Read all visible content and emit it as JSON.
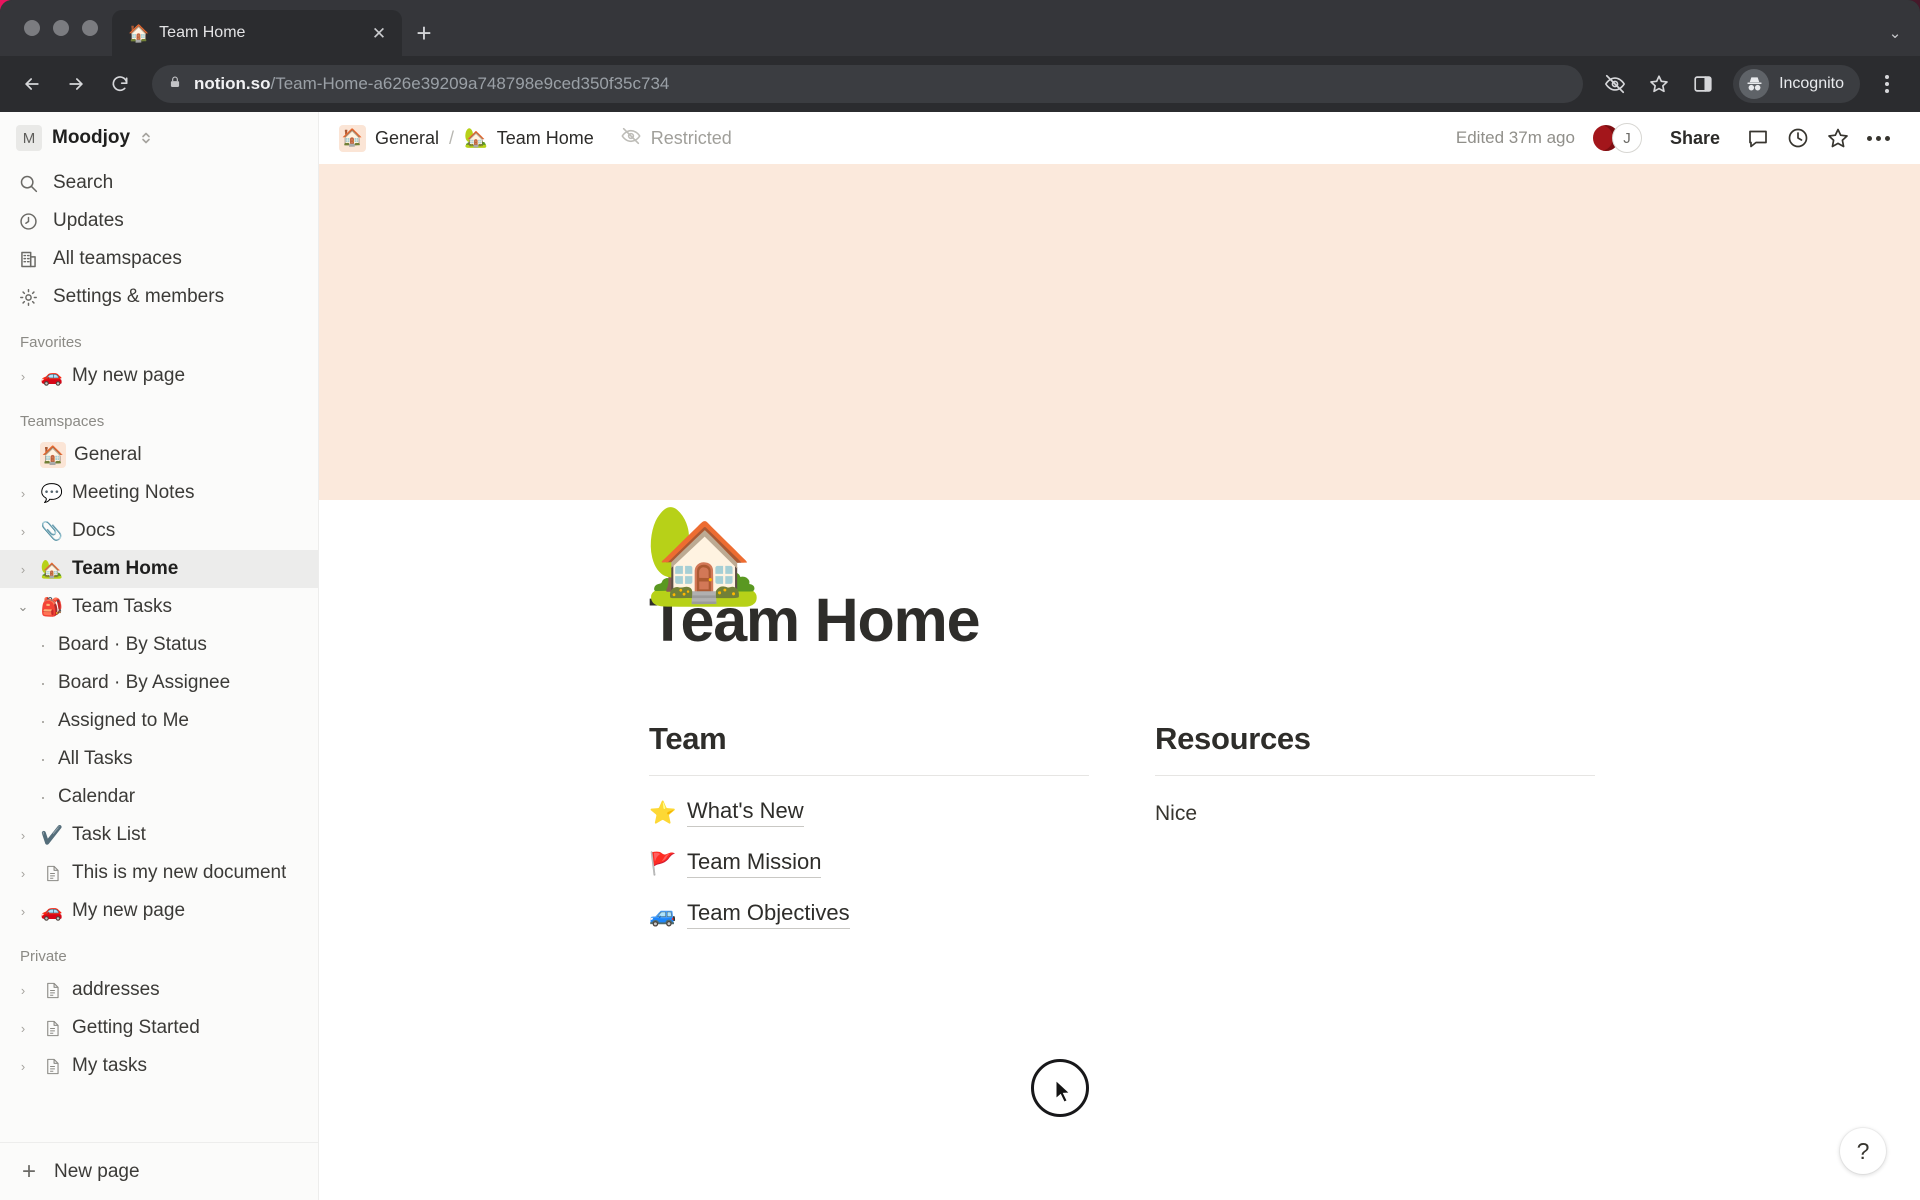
{
  "browser": {
    "tab": {
      "favicon": "🏠",
      "title": "Team Home",
      "close": "✕"
    },
    "new_tab_label": "+",
    "tab_list_chevron": "⌄",
    "omnibox": {
      "host": "notion.so",
      "path": "/Team-Home-a626e39209a748798e9ced350f35c734"
    },
    "profile_label": "Incognito",
    "icons": {
      "back": "back-arrow-icon",
      "forward": "forward-arrow-icon",
      "reload": "reload-icon",
      "lock": "lock-icon",
      "cookies_blocked": "eye-off-icon",
      "bookmark": "star-icon",
      "side_panel": "side-panel-icon",
      "menu": "kebab-menu-icon"
    }
  },
  "sidebar": {
    "workspace": {
      "initial": "M",
      "name": "Moodjoy",
      "chevron": "⌃⌄"
    },
    "quick_items": [
      {
        "label": "Search",
        "icon": "search-icon"
      },
      {
        "label": "Updates",
        "icon": "clock-icon"
      },
      {
        "label": "All teamspaces",
        "icon": "building-icon"
      },
      {
        "label": "Settings & members",
        "icon": "gear-icon"
      }
    ],
    "sections": [
      {
        "title": "Favorites",
        "items": [
          {
            "label": "My new page",
            "emoji": "🚗",
            "caret": "›",
            "depth": 0
          }
        ]
      },
      {
        "title": "Teamspaces",
        "items": [
          {
            "label": "General",
            "emoji": "🏠",
            "caret": "",
            "depth": 0,
            "chip": true
          },
          {
            "label": "Meeting Notes",
            "emoji": "💬",
            "caret": "›",
            "depth": 0
          },
          {
            "label": "Docs",
            "emoji": "📎",
            "caret": "›",
            "depth": 0
          },
          {
            "label": "Team Home",
            "emoji": "🏡",
            "caret": "›",
            "depth": 0,
            "selected": true
          },
          {
            "label": "Team Tasks",
            "emoji": "🎒",
            "caret": "⌄",
            "depth": 0,
            "open": true
          },
          {
            "label": "Board · By Status",
            "depth": 1
          },
          {
            "label": "Board · By Assignee",
            "depth": 1
          },
          {
            "label": "Assigned to Me",
            "depth": 1
          },
          {
            "label": "All Tasks",
            "depth": 1
          },
          {
            "label": "Calendar",
            "depth": 1
          },
          {
            "label": "Task List",
            "emoji": "✔️",
            "caret": "›",
            "depth": 0
          },
          {
            "label": "This is my new document",
            "icon": "document-icon",
            "caret": "›",
            "depth": 0
          },
          {
            "label": "My new page",
            "emoji": "🚗",
            "caret": "›",
            "depth": 0
          }
        ]
      },
      {
        "title": "Private",
        "items": [
          {
            "label": "addresses",
            "icon": "document-icon",
            "caret": "›",
            "depth": 0
          },
          {
            "label": "Getting Started",
            "icon": "document-icon",
            "caret": "›",
            "depth": 0
          },
          {
            "label": "My tasks",
            "icon": "document-icon",
            "caret": "›",
            "depth": 0
          }
        ]
      }
    ],
    "footer": {
      "label": "New page",
      "icon": "plus-icon"
    }
  },
  "topbar": {
    "breadcrumb": [
      {
        "label": "General",
        "emoji": "🏠",
        "chip": true
      },
      {
        "label": "Team Home",
        "emoji": "🏡"
      }
    ],
    "separator": "/",
    "restricted_label": "Restricted",
    "edited_label": "Edited 37m ago",
    "avatars": [
      {
        "initial": "",
        "color": "#a3161b"
      },
      {
        "initial": "J",
        "color": "#ffffff"
      }
    ],
    "share_label": "Share",
    "icons": {
      "comments": "comment-icon",
      "history": "clock-icon",
      "favorite": "star-icon",
      "more": "ellipsis-icon"
    }
  },
  "page": {
    "cover_color": "#fbe9dc",
    "emoji": "🏡",
    "title": "Team Home",
    "columns": [
      {
        "heading": "Team",
        "links": [
          {
            "emoji": "⭐",
            "label": "What's New"
          },
          {
            "emoji": "🚩",
            "label": "Team Mission"
          },
          {
            "emoji": "🚙",
            "label": "Team Objectives"
          }
        ],
        "text": ""
      },
      {
        "heading": "Resources",
        "links": [],
        "text": "Nice"
      }
    ]
  },
  "help": {
    "label": "?"
  }
}
